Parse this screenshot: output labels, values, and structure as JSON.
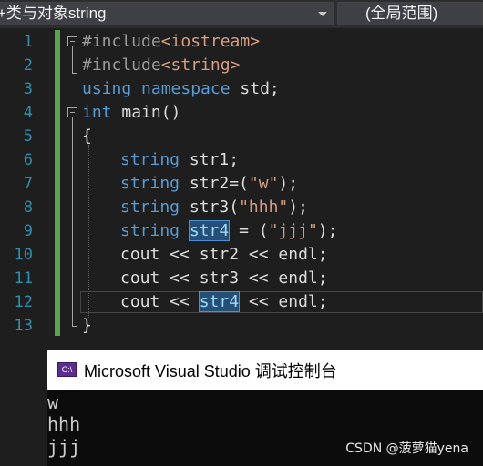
{
  "navbar": {
    "scope_dropdown": "+类与对象string",
    "member_dropdown": "(全局范围)"
  },
  "editor": {
    "line_numbers": [
      "1",
      "2",
      "3",
      "4",
      "5",
      "6",
      "7",
      "8",
      "9",
      "10",
      "11",
      "12",
      "13"
    ],
    "lines": {
      "l1_pp": "#include",
      "l1_str": "<iostream>",
      "l2_pp": "#include",
      "l2_str": "<string>",
      "l3_kw1": "using",
      "l3_kw2": "namespace",
      "l3_rest": "std;",
      "l4_kw": "int",
      "l4_rest": "main()",
      "l5": "{",
      "l6_kw": "string",
      "l6_rest": "str1;",
      "l7_kw": "string",
      "l7_a": "str2=(",
      "l7_str": "\"w\"",
      "l7_b": ");",
      "l8_kw": "string",
      "l8_a": "str3(",
      "l8_str": "\"hhh\"",
      "l8_b": ");",
      "l9_kw": "string",
      "l9_hl": "str4",
      "l9_a": " = (",
      "l9_str": "\"jjj\"",
      "l9_b": ");",
      "l10": "cout << str2 << endl;",
      "l11": "cout << str3 << endl;",
      "l12_a": "cout << ",
      "l12_hl": "str4",
      "l12_b": " << endl;",
      "l13": "}"
    }
  },
  "console": {
    "title": "Microsoft Visual Studio 调试控制台",
    "icon_text": "C:\\",
    "output": [
      "w",
      "hhh",
      "jjj"
    ]
  },
  "watermark": "CSDN @菠萝猫yena",
  "colors": {
    "background": "#1e1e1e",
    "keyword": "#569cd6",
    "string": "#d69d85",
    "line_number": "#2b91af",
    "change_bar": "#57a64a",
    "highlight": "#264f78"
  }
}
